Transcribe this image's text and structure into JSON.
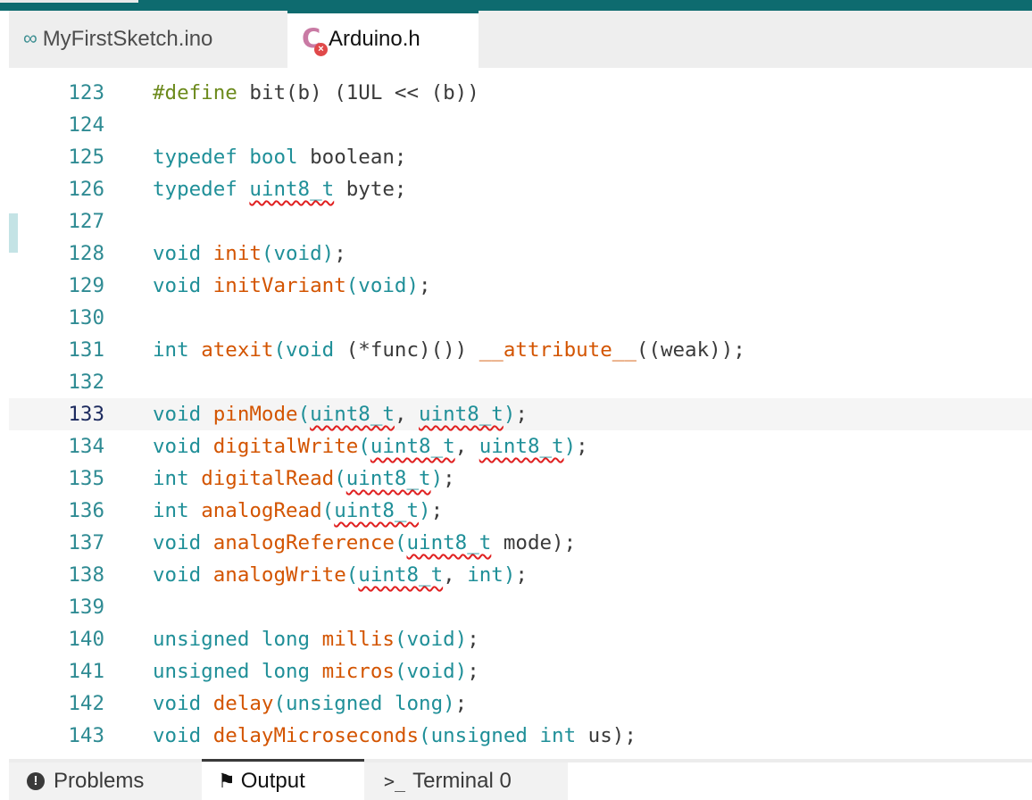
{
  "tabs": [
    {
      "label": "MyFirstSketch.ino",
      "icon": "infinity-icon",
      "active": false
    },
    {
      "label": "Arduino.h",
      "icon": "c-file-error-icon",
      "active": true
    }
  ],
  "editor": {
    "current_line": "133",
    "lines": [
      {
        "n": "123",
        "tokens": [
          [
            "pp",
            "#define"
          ],
          [
            "id",
            " bit(b) (1UL << (b))"
          ]
        ]
      },
      {
        "n": "124",
        "tokens": []
      },
      {
        "n": "125",
        "tokens": [
          [
            "kw",
            "typedef"
          ],
          [
            "id",
            " "
          ],
          [
            "kw",
            "bool"
          ],
          [
            "id",
            " boolean;"
          ]
        ]
      },
      {
        "n": "126",
        "tokens": [
          [
            "kw",
            "typedef"
          ],
          [
            "id",
            " "
          ],
          [
            "kwsq",
            "uint8_t"
          ],
          [
            "id",
            " byte;"
          ]
        ]
      },
      {
        "n": "127",
        "tokens": []
      },
      {
        "n": "128",
        "tokens": [
          [
            "kw",
            "void"
          ],
          [
            "id",
            " "
          ],
          [
            "fn",
            "init"
          ],
          [
            "kw",
            "("
          ],
          [
            "kw",
            "void"
          ],
          [
            "kw",
            ")"
          ],
          [
            "id",
            ";"
          ]
        ]
      },
      {
        "n": "129",
        "tokens": [
          [
            "kw",
            "void"
          ],
          [
            "id",
            " "
          ],
          [
            "fn",
            "initVariant"
          ],
          [
            "kw",
            "("
          ],
          [
            "kw",
            "void"
          ],
          [
            "kw",
            ")"
          ],
          [
            "id",
            ";"
          ]
        ]
      },
      {
        "n": "130",
        "tokens": []
      },
      {
        "n": "131",
        "tokens": [
          [
            "kw",
            "int"
          ],
          [
            "id",
            " "
          ],
          [
            "fn",
            "atexit"
          ],
          [
            "kw",
            "("
          ],
          [
            "kw",
            "void"
          ],
          [
            "id",
            " (*func)()) "
          ],
          [
            "at",
            "__attribute__"
          ],
          [
            "id",
            "((weak));"
          ]
        ]
      },
      {
        "n": "132",
        "tokens": []
      },
      {
        "n": "133",
        "tokens": [
          [
            "kw",
            "void"
          ],
          [
            "id",
            " "
          ],
          [
            "fn",
            "pinMode"
          ],
          [
            "kw",
            "("
          ],
          [
            "kwsq",
            "uint8_t"
          ],
          [
            "id",
            ", "
          ],
          [
            "kwsq",
            "uint8_t"
          ],
          [
            "kw",
            ")"
          ],
          [
            "id",
            ";"
          ]
        ]
      },
      {
        "n": "134",
        "tokens": [
          [
            "kw",
            "void"
          ],
          [
            "id",
            " "
          ],
          [
            "fn",
            "digitalWrite"
          ],
          [
            "kw",
            "("
          ],
          [
            "kwsq",
            "uint8_t"
          ],
          [
            "id",
            ", "
          ],
          [
            "kwsq",
            "uint8_t"
          ],
          [
            "kw",
            ")"
          ],
          [
            "id",
            ";"
          ]
        ]
      },
      {
        "n": "135",
        "tokens": [
          [
            "kw",
            "int"
          ],
          [
            "id",
            " "
          ],
          [
            "fn",
            "digitalRead"
          ],
          [
            "kw",
            "("
          ],
          [
            "kwsq",
            "uint8_t"
          ],
          [
            "kw",
            ")"
          ],
          [
            "id",
            ";"
          ]
        ]
      },
      {
        "n": "136",
        "tokens": [
          [
            "kw",
            "int"
          ],
          [
            "id",
            " "
          ],
          [
            "fn",
            "analogRead"
          ],
          [
            "kw",
            "("
          ],
          [
            "kwsq",
            "uint8_t"
          ],
          [
            "kw",
            ")"
          ],
          [
            "id",
            ";"
          ]
        ]
      },
      {
        "n": "137",
        "tokens": [
          [
            "kw",
            "void"
          ],
          [
            "id",
            " "
          ],
          [
            "fn",
            "analogReference"
          ],
          [
            "kw",
            "("
          ],
          [
            "kwsq",
            "uint8_t"
          ],
          [
            "id",
            " mode);"
          ]
        ]
      },
      {
        "n": "138",
        "tokens": [
          [
            "kw",
            "void"
          ],
          [
            "id",
            " "
          ],
          [
            "fn",
            "analogWrite"
          ],
          [
            "kw",
            "("
          ],
          [
            "kwsq",
            "uint8_t"
          ],
          [
            "id",
            ", "
          ],
          [
            "kw",
            "int"
          ],
          [
            "kw",
            ")"
          ],
          [
            "id",
            ";"
          ]
        ]
      },
      {
        "n": "139",
        "tokens": []
      },
      {
        "n": "140",
        "tokens": [
          [
            "kw",
            "unsigned"
          ],
          [
            "id",
            " "
          ],
          [
            "kw",
            "long"
          ],
          [
            "id",
            " "
          ],
          [
            "fn",
            "millis"
          ],
          [
            "kw",
            "("
          ],
          [
            "kw",
            "void"
          ],
          [
            "kw",
            ")"
          ],
          [
            "id",
            ";"
          ]
        ]
      },
      {
        "n": "141",
        "tokens": [
          [
            "kw",
            "unsigned"
          ],
          [
            "id",
            " "
          ],
          [
            "kw",
            "long"
          ],
          [
            "id",
            " "
          ],
          [
            "fn",
            "micros"
          ],
          [
            "kw",
            "("
          ],
          [
            "kw",
            "void"
          ],
          [
            "kw",
            ")"
          ],
          [
            "id",
            ";"
          ]
        ]
      },
      {
        "n": "142",
        "tokens": [
          [
            "kw",
            "void"
          ],
          [
            "id",
            " "
          ],
          [
            "fn",
            "delay"
          ],
          [
            "kw",
            "("
          ],
          [
            "kw",
            "unsigned"
          ],
          [
            "id",
            " "
          ],
          [
            "kw",
            "long"
          ],
          [
            "kw",
            ")"
          ],
          [
            "id",
            ";"
          ]
        ]
      },
      {
        "n": "143",
        "tokens": [
          [
            "kw",
            "void"
          ],
          [
            "id",
            " "
          ],
          [
            "fn",
            "delayMicroseconds"
          ],
          [
            "kw",
            "("
          ],
          [
            "kw",
            "unsigned"
          ],
          [
            "id",
            " "
          ],
          [
            "kw",
            "int"
          ],
          [
            "id",
            " us);"
          ]
        ]
      }
    ]
  },
  "panel": {
    "tabs": [
      {
        "label": "Problems",
        "icon": "error-circle-icon"
      },
      {
        "label": "Output",
        "icon": "flag-icon"
      },
      {
        "label": "Terminal 0",
        "icon": "terminal-icon"
      }
    ]
  },
  "colors": {
    "keyword": "#1f8f98",
    "function": "#d35400",
    "preprocessor": "#6c8a1c",
    "error_squiggle": "#e02020",
    "topbar": "#0e6b6f"
  }
}
